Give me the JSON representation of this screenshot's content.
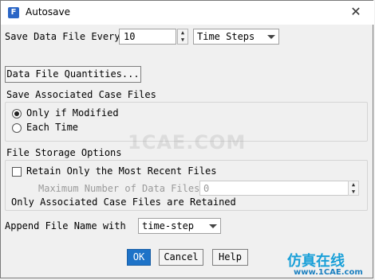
{
  "window": {
    "title": "Autosave",
    "icon_letter": "F"
  },
  "save_every": {
    "label": "Save Data File Every",
    "value": "10",
    "unit": "Time Steps"
  },
  "data_file_quantities_button": "Data File Quantities...",
  "case_files": {
    "heading": "Save Associated Case Files",
    "options": [
      "Only if Modified",
      "Each Time"
    ],
    "selected": "Only if Modified"
  },
  "storage": {
    "heading": "File Storage Options",
    "retain_label": "Retain Only the Most Recent Files",
    "retain_checked": false,
    "max_label": "Maximum Number of Data Files",
    "max_value": "0",
    "note": "Only Associated Case Files are Retained"
  },
  "append": {
    "label": "Append File Name with",
    "value": "time-step"
  },
  "buttons": {
    "ok": "OK",
    "cancel": "Cancel",
    "help": "Help"
  },
  "watermark": {
    "text": "1CAE.COM",
    "brand": "仿真在线",
    "brand_url": "www.1CAE.com"
  },
  "colors": {
    "accent": "#1e73c8",
    "title_bg": "#ffffff",
    "dialog_bg": "#f0f0f0"
  }
}
